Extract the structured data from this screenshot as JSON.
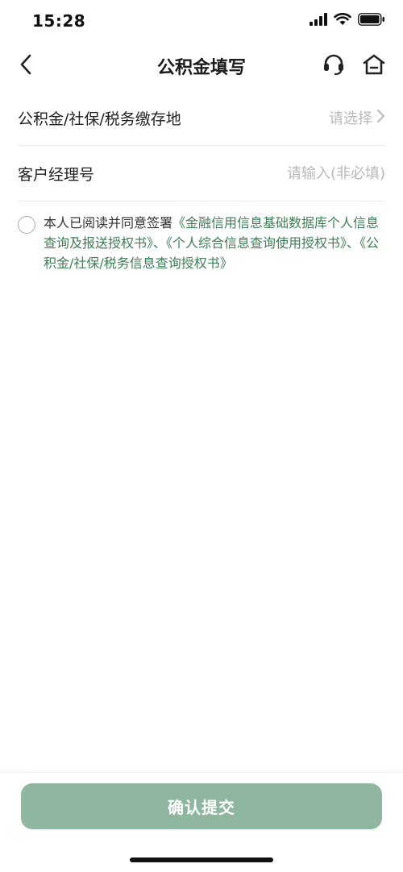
{
  "status_bar": {
    "time": "15:28"
  },
  "header": {
    "title": "公积金填写",
    "back_icon": "chevron-left-icon",
    "support_icon": "headset-icon",
    "home_icon": "home-icon"
  },
  "form": {
    "location": {
      "label": "公积金/社保/税务缴存地",
      "placeholder": "请选择"
    },
    "manager": {
      "label": "客户经理号",
      "placeholder": "请输入(非必填)"
    }
  },
  "agreement": {
    "prefix": "本人已阅读并同意签署",
    "link1": "《金融信用信息基础数据库个人信息查询及报送授权书》",
    "sep1": "、",
    "link2": "《个人综合信息查询使用授权书》",
    "sep2": "、",
    "link3": "《公积金/社保/税务信息查询授权书》"
  },
  "footer": {
    "confirm_label": "确认提交"
  },
  "colors": {
    "accent": "#3e7d55",
    "button_bg": "#8fb79f",
    "placeholder": "#b9b9b9"
  }
}
